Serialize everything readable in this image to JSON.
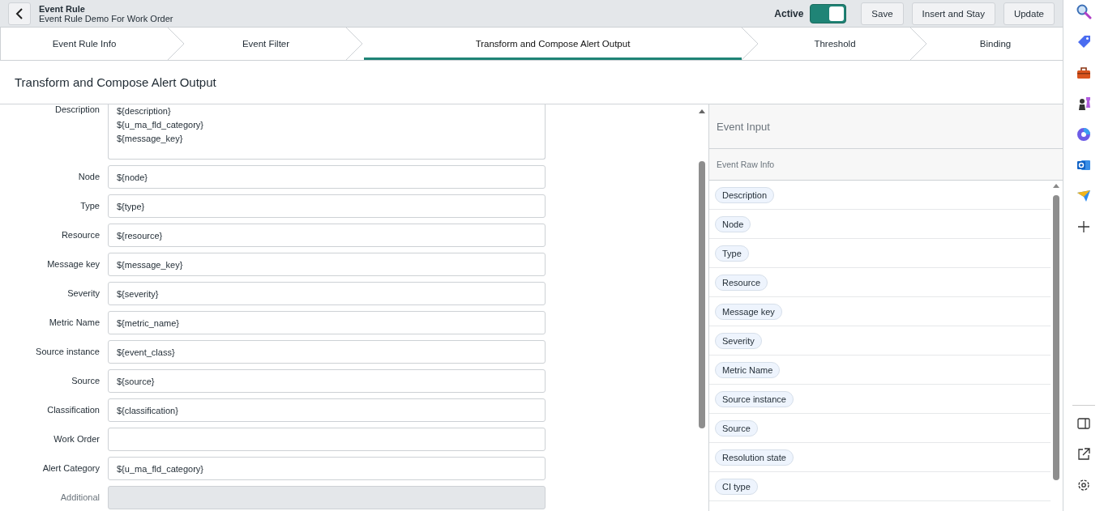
{
  "header": {
    "title": "Event Rule",
    "subtitle": "Event Rule Demo For Work Order",
    "active": {
      "label": "Active",
      "on": true
    },
    "buttons": [
      "Save",
      "Insert and Stay",
      "Update"
    ]
  },
  "steps": [
    {
      "label": "Event Rule Info",
      "selected": false
    },
    {
      "label": "Event Filter",
      "selected": false
    },
    {
      "label": "Transform and Compose Alert Output",
      "selected": true
    },
    {
      "label": "Threshold",
      "selected": false
    },
    {
      "label": "Binding",
      "selected": false
    }
  ],
  "section_title": "Transform and Compose Alert Output",
  "fields": [
    {
      "label": "Description",
      "kind": "textarea",
      "value": "${description}\n${u_ma_fld_category}\n${message_key}",
      "disabled": false
    },
    {
      "label": "Node",
      "kind": "input",
      "value": "${node}",
      "disabled": false
    },
    {
      "label": "Type",
      "kind": "input",
      "value": "${type}",
      "disabled": false
    },
    {
      "label": "Resource",
      "kind": "input",
      "value": "${resource}",
      "disabled": false
    },
    {
      "label": "Message key",
      "kind": "input",
      "value": "${message_key}",
      "disabled": false
    },
    {
      "label": "Severity",
      "kind": "input",
      "value": "${severity}",
      "disabled": false
    },
    {
      "label": "Metric Name",
      "kind": "input",
      "value": "${metric_name}",
      "disabled": false
    },
    {
      "label": "Source instance",
      "kind": "input",
      "value": "${event_class}",
      "disabled": false
    },
    {
      "label": "Source",
      "kind": "input",
      "value": "${source}",
      "disabled": false
    },
    {
      "label": "Classification",
      "kind": "input",
      "value": "${classification}",
      "disabled": false
    },
    {
      "label": "Work Order",
      "kind": "input",
      "disabled": false
    },
    {
      "label": "Alert Category",
      "kind": "input",
      "value": "${u_ma_fld_category}",
      "disabled": false
    },
    {
      "label": "Additional",
      "kind": "input",
      "disabled": true
    }
  ],
  "event_input": {
    "title": "Event Input",
    "subtitle": "Event Raw Info",
    "chips": [
      "Description",
      "Node",
      "Type",
      "Resource",
      "Message key",
      "Severity",
      "Metric Name",
      "Source instance",
      "Source",
      "Resolution state",
      "CI type"
    ]
  }
}
